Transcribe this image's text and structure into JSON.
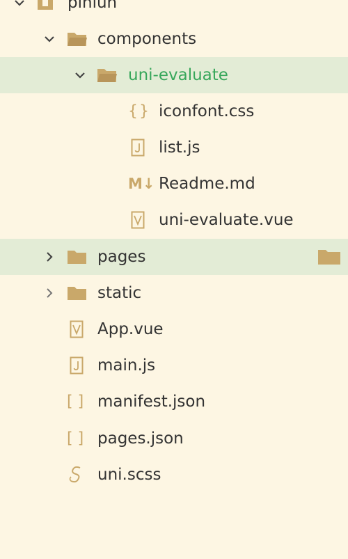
{
  "explorer": {
    "items": [
      {
        "label": "pinlun",
        "type": "project"
      },
      {
        "label": "components",
        "type": "folder"
      },
      {
        "label": "uni-evaluate",
        "type": "folder"
      },
      {
        "label": "iconfont.css",
        "type": "css"
      },
      {
        "label": "list.js",
        "type": "js"
      },
      {
        "label": "Readme.md",
        "type": "md"
      },
      {
        "label": "uni-evaluate.vue",
        "type": "vue"
      },
      {
        "label": "pages",
        "type": "folder"
      },
      {
        "label": "static",
        "type": "folder"
      },
      {
        "label": "App.vue",
        "type": "vue"
      },
      {
        "label": "main.js",
        "type": "js"
      },
      {
        "label": "manifest.json",
        "type": "json"
      },
      {
        "label": "pages.json",
        "type": "json"
      },
      {
        "label": "uni.scss",
        "type": "scss"
      }
    ],
    "icons": {
      "folder_color": "#c9a86a",
      "file_outline_color": "#c9a86a",
      "css_glyph": "{}",
      "md_glyph": "M↓",
      "json_glyph": "[ ]"
    },
    "colors": {
      "background": "#fdf6e3",
      "selected_row": "#e3ecd6",
      "active_text": "#37a75b",
      "text": "#333333"
    }
  }
}
